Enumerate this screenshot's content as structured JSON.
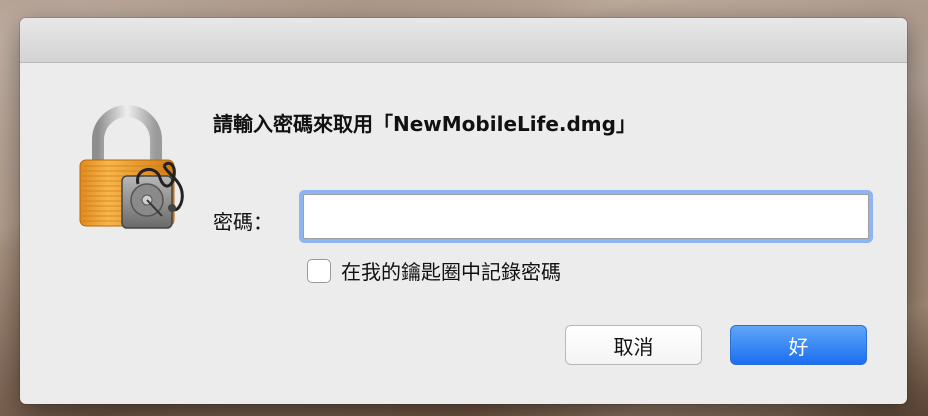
{
  "dialog": {
    "title": "請輸入密碼來取用「NewMobileLife.dmg」",
    "password_label": "密碼：",
    "password_value": "",
    "remember_label": "在我的鑰匙圈中記錄密碼",
    "remember_checked": false,
    "cancel_label": "取消",
    "ok_label": "好"
  },
  "colors": {
    "accent": "#1b6ff0",
    "dialog_bg": "#ececec",
    "focus_ring": "#8fb4f0",
    "lock_body": "#f0a23a"
  },
  "icons": {
    "lock": "disk-utility-lock-icon"
  }
}
